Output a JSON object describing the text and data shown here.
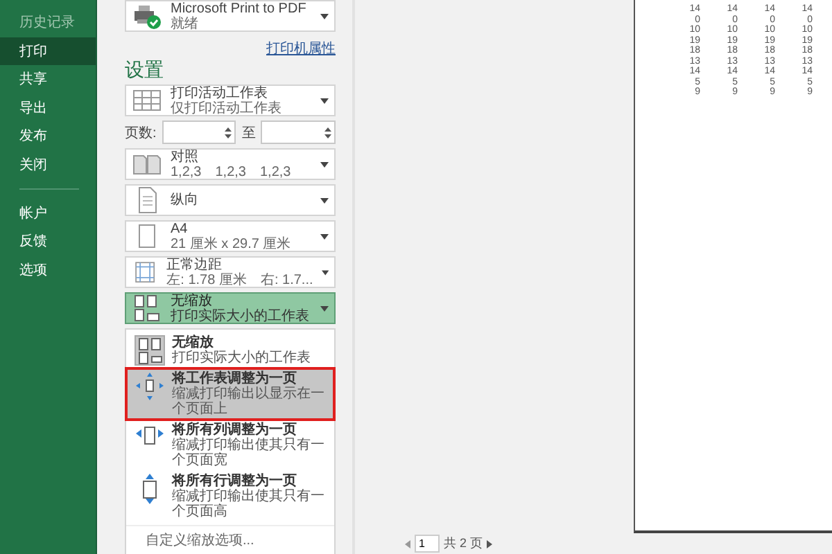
{
  "sidebar": {
    "items": [
      {
        "label": "历史记录",
        "selected": false,
        "disabled": true
      },
      {
        "label": "打印",
        "selected": true,
        "disabled": false
      },
      {
        "label": "共享",
        "selected": false,
        "disabled": false
      },
      {
        "label": "导出",
        "selected": false,
        "disabled": false
      },
      {
        "label": "发布",
        "selected": false,
        "disabled": false
      },
      {
        "label": "关闭",
        "selected": false,
        "disabled": false
      }
    ],
    "bottom_items": [
      {
        "label": "帐户",
        "selected": false,
        "disabled": false
      },
      {
        "label": "反馈",
        "selected": false,
        "disabled": false
      },
      {
        "label": "选项",
        "selected": false,
        "disabled": false
      }
    ]
  },
  "printer": {
    "name": "Microsoft Print to PDF",
    "status": "就绪",
    "properties_link": "打印机属性"
  },
  "settings": {
    "heading": "设置",
    "items": [
      {
        "kind": "sheets",
        "title": "打印活动工作表",
        "subtitle": [
          "仅打印活动工作表"
        ],
        "expanded": false
      },
      {
        "kind": "pages",
        "label": "页数:",
        "to_label": "至"
      },
      {
        "kind": "collate",
        "title": "对照",
        "subtitle": [
          "1,2,3",
          "1,2,3",
          "1,2,3"
        ],
        "expanded": false
      },
      {
        "kind": "orientation",
        "title": "纵向",
        "expanded": false
      },
      {
        "kind": "paper",
        "title": "A4",
        "subtitle": [
          "21 厘米 x 29.7 厘米"
        ],
        "expanded": false
      },
      {
        "kind": "margins",
        "title": "正常边距",
        "subtitle": [
          "左: 1.78 厘米",
          "右: 1.7..."
        ],
        "expanded": false
      },
      {
        "kind": "scaling",
        "title": "无缩放",
        "subtitle": [
          "打印实际大小的工作表"
        ],
        "expanded": true
      }
    ]
  },
  "scaling_menu": {
    "items": [
      {
        "kind": "no-scaling",
        "title": "无缩放",
        "description": "打印实际大小的工作表",
        "selected": false,
        "annotated": false
      },
      {
        "kind": "fit-sheet",
        "title": "将工作表调整为一页",
        "description": "缩减打印输出以显示在一个页面上",
        "selected": true,
        "annotated": true
      },
      {
        "kind": "fit-columns",
        "title": "将所有列调整为一页",
        "description": "缩减打印输出使其只有一个页面宽",
        "selected": false,
        "annotated": false
      },
      {
        "kind": "fit-rows",
        "title": "将所有行调整为一页",
        "description": "缩减打印输出使其只有一个页面高",
        "selected": false,
        "annotated": false
      }
    ],
    "footer": "自定义缩放选项..."
  },
  "preview": {
    "rows": [
      [
        "14",
        "14",
        "14",
        "14"
      ],
      [
        "0",
        "0",
        "0",
        "0"
      ],
      [
        "10",
        "10",
        "10",
        "10"
      ],
      [
        "19",
        "19",
        "19",
        "19"
      ],
      [
        "18",
        "18",
        "18",
        "18"
      ],
      [
        "13",
        "13",
        "13",
        "13"
      ],
      [
        "14",
        "14",
        "14",
        "14"
      ],
      [
        "5",
        "5",
        "5",
        "5"
      ],
      [
        "9",
        "9",
        "9",
        "9"
      ]
    ]
  },
  "page_nav": {
    "current_page": "1",
    "total": "共 2 页"
  }
}
